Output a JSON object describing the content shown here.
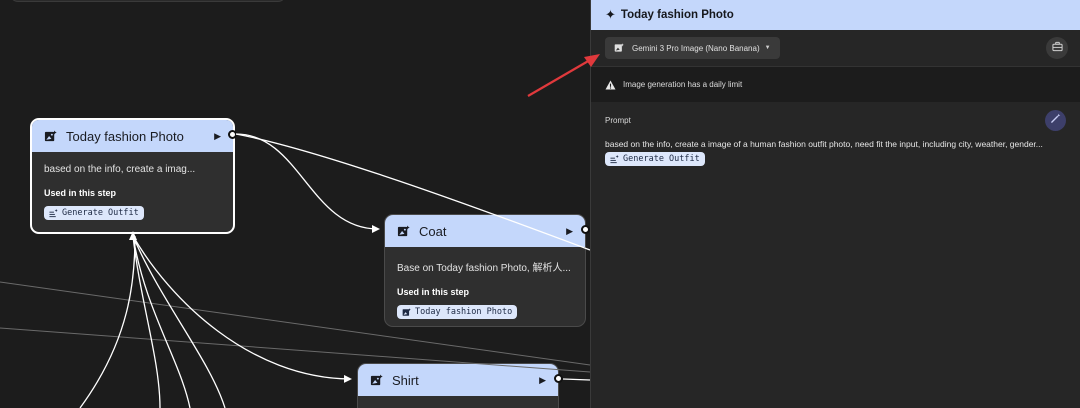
{
  "colors": {
    "canvas_bg": "#1c1c1c",
    "node_header": "#c4d7fb",
    "node_body": "#2f2f2f",
    "chip_bg": "#dde7fb",
    "panel_bg": "#262626",
    "arrow_red": "#e0393c"
  },
  "canvas": {
    "nodes": [
      {
        "title": "Today fashion Photo",
        "icon": "image-spark-icon",
        "description": "based on the info, create a imag...",
        "used_label": "Used in this step",
        "chip": "Generate Outfit",
        "chip_icon": "sparkle-list-icon"
      },
      {
        "title": "Coat",
        "icon": "image-spark-icon",
        "description": "Base on Today fashion Photo, 解析人...",
        "used_label": "Used in this step",
        "chip": "Today fashion Photo",
        "chip_icon": "image-spark-icon"
      },
      {
        "title": "Shirt",
        "icon": "image-spark-icon"
      }
    ]
  },
  "panel": {
    "title": "Today fashion Photo",
    "title_icon": "sparkle-icon",
    "model": {
      "label": "Gemini 3 Pro Image (Nano Banana)",
      "icon": "image-spark-icon"
    },
    "tools_icon": "briefcase-icon",
    "warning": {
      "icon": "warning-icon",
      "text": "Image generation has a daily limit"
    },
    "prompt": {
      "label": "Prompt",
      "text": "based on the info, create a image of a human fashion outfit photo, need fit the input, including city, weather, gender...",
      "chip": "Generate Outfit",
      "wand_icon": "magic-wand-icon"
    }
  }
}
